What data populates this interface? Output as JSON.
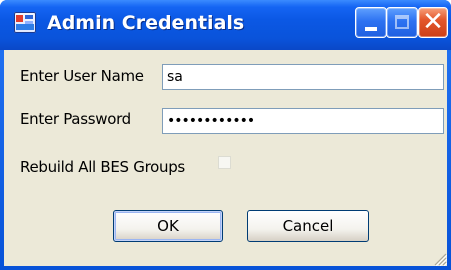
{
  "window": {
    "title": "Admin Credentials",
    "icon": "app-window-icon"
  },
  "titlebar_buttons": {
    "minimize_icon": "minimize-icon",
    "maximize_icon": "maximize-icon",
    "close_symbol": "✕"
  },
  "form": {
    "user_name_label": "Enter User Name",
    "user_name_value": "sa",
    "password_label": "Enter Password",
    "password_value": "••••••••••••",
    "rebuild_label": "Rebuild All BES Groups",
    "rebuild_checked": false
  },
  "buttons": {
    "ok_label": "OK",
    "cancel_label": "Cancel"
  },
  "colors": {
    "titlebar": "#0a53da",
    "close_button": "#e4572c",
    "client_background": "#ece9d8"
  }
}
